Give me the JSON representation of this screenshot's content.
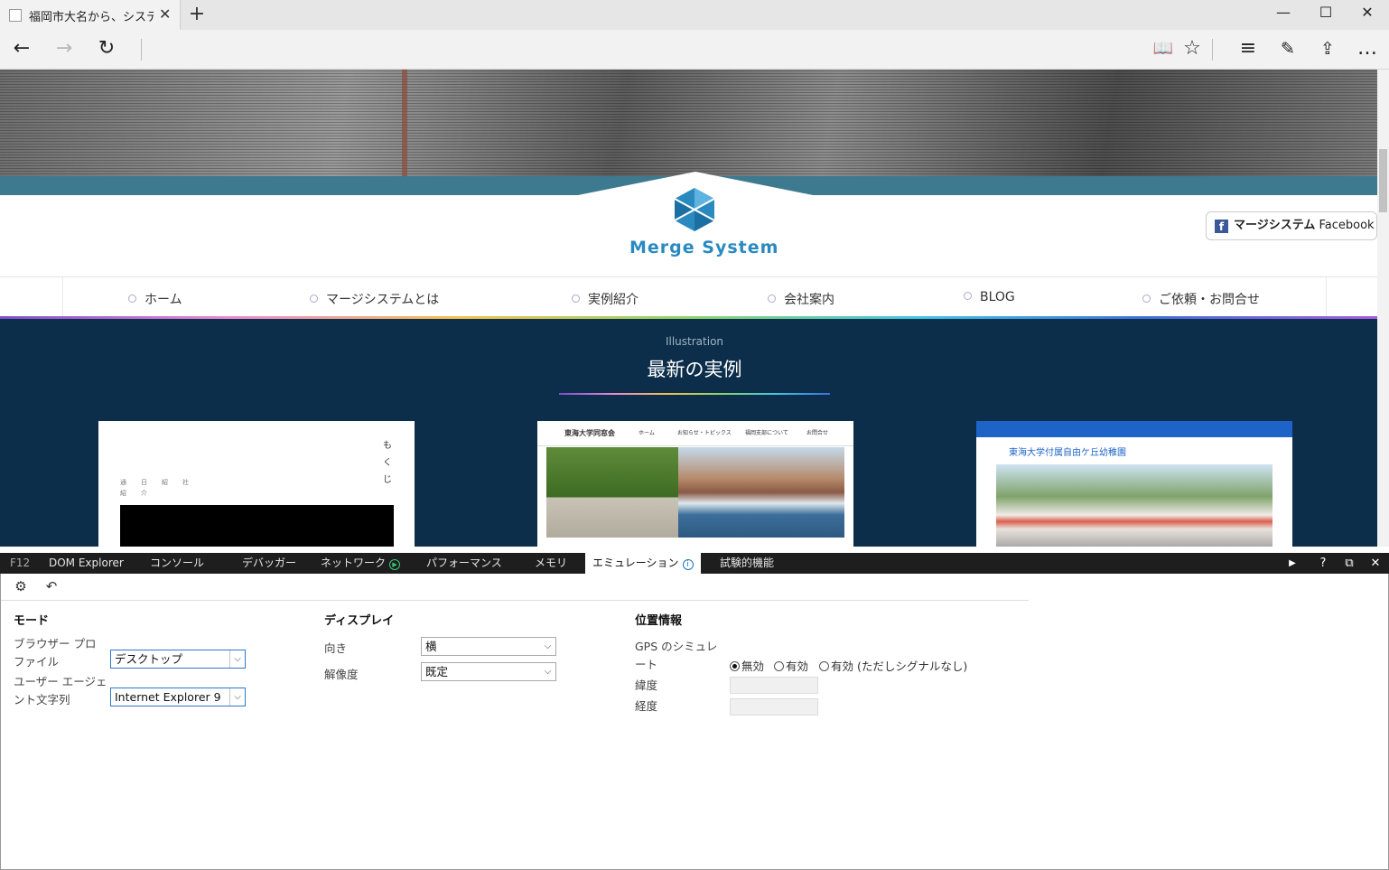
{
  "browser": {
    "tab_title": "福岡市大名から、システム開発",
    "tab_close": "✕",
    "new_tab": "+",
    "window_buttons": [
      "—",
      "☐",
      "✕"
    ],
    "nav": {
      "back": "←",
      "forward": "→",
      "refresh": "↻"
    },
    "toolbar_icons": [
      "reading-view-icon",
      "favorites-star-icon",
      "hub-icon",
      "web-note-icon",
      "share-icon",
      "more-icon"
    ],
    "toolbar_glyphs": {
      "reading": "📖",
      "favorite": "☆",
      "hub": "≡",
      "note": "✎",
      "share": "⇪",
      "more": "…"
    }
  },
  "site": {
    "logo_text": "Merge System",
    "facebook": {
      "icon": "f",
      "brand": "マージシステム",
      "label": "Facebook"
    },
    "menu": [
      "ホーム",
      "マージシステムとは",
      "実例紹介",
      "会社案内",
      "BLOG",
      "ご依頼・お問合せ"
    ],
    "section": {
      "subtitle": "Illustration",
      "title": "最新の実例"
    },
    "card1": {
      "vertical": "もくじ",
      "small_cols": [
        "通紹",
        "日介",
        "紹",
        "社"
      ]
    },
    "card2": {
      "org": "東海大学同窓会",
      "links": [
        "ホーム",
        "お知らせ・トピックス",
        "福岡支部について",
        "お問合せ"
      ]
    },
    "card3": {
      "title": "東海大学付属自由ケ丘幼稚園"
    }
  },
  "devtools": {
    "tabs": [
      "F12",
      "DOM Explorer",
      "コンソール",
      "デバッガー",
      "ネットワーク",
      "パフォーマンス",
      "メモリ",
      "エミュレーション",
      "試験的機能"
    ],
    "controls": [
      "▶",
      "?",
      "⧉",
      "✕"
    ],
    "toolbar_glyphs": [
      "⚙",
      "↶"
    ],
    "mode": {
      "title": "モード",
      "browser_profile_label": "ブラウザー プロファイル",
      "browser_profile_value": "デスクトップ",
      "user_agent_label": "ユーザー エージェント文字列",
      "user_agent_value": "Internet Explorer 9"
    },
    "display": {
      "title": "ディスプレイ",
      "orientation_label": "向き",
      "orientation_value": "横",
      "resolution_label": "解像度",
      "resolution_value": "既定"
    },
    "geolocation": {
      "title": "位置情報",
      "gps_label": "GPS のシミュレート",
      "options": [
        "無効",
        "有効",
        "有効 (ただしシグナルなし)"
      ],
      "selected": "無効",
      "latitude_label": "緯度",
      "longitude_label": "経度"
    }
  }
}
